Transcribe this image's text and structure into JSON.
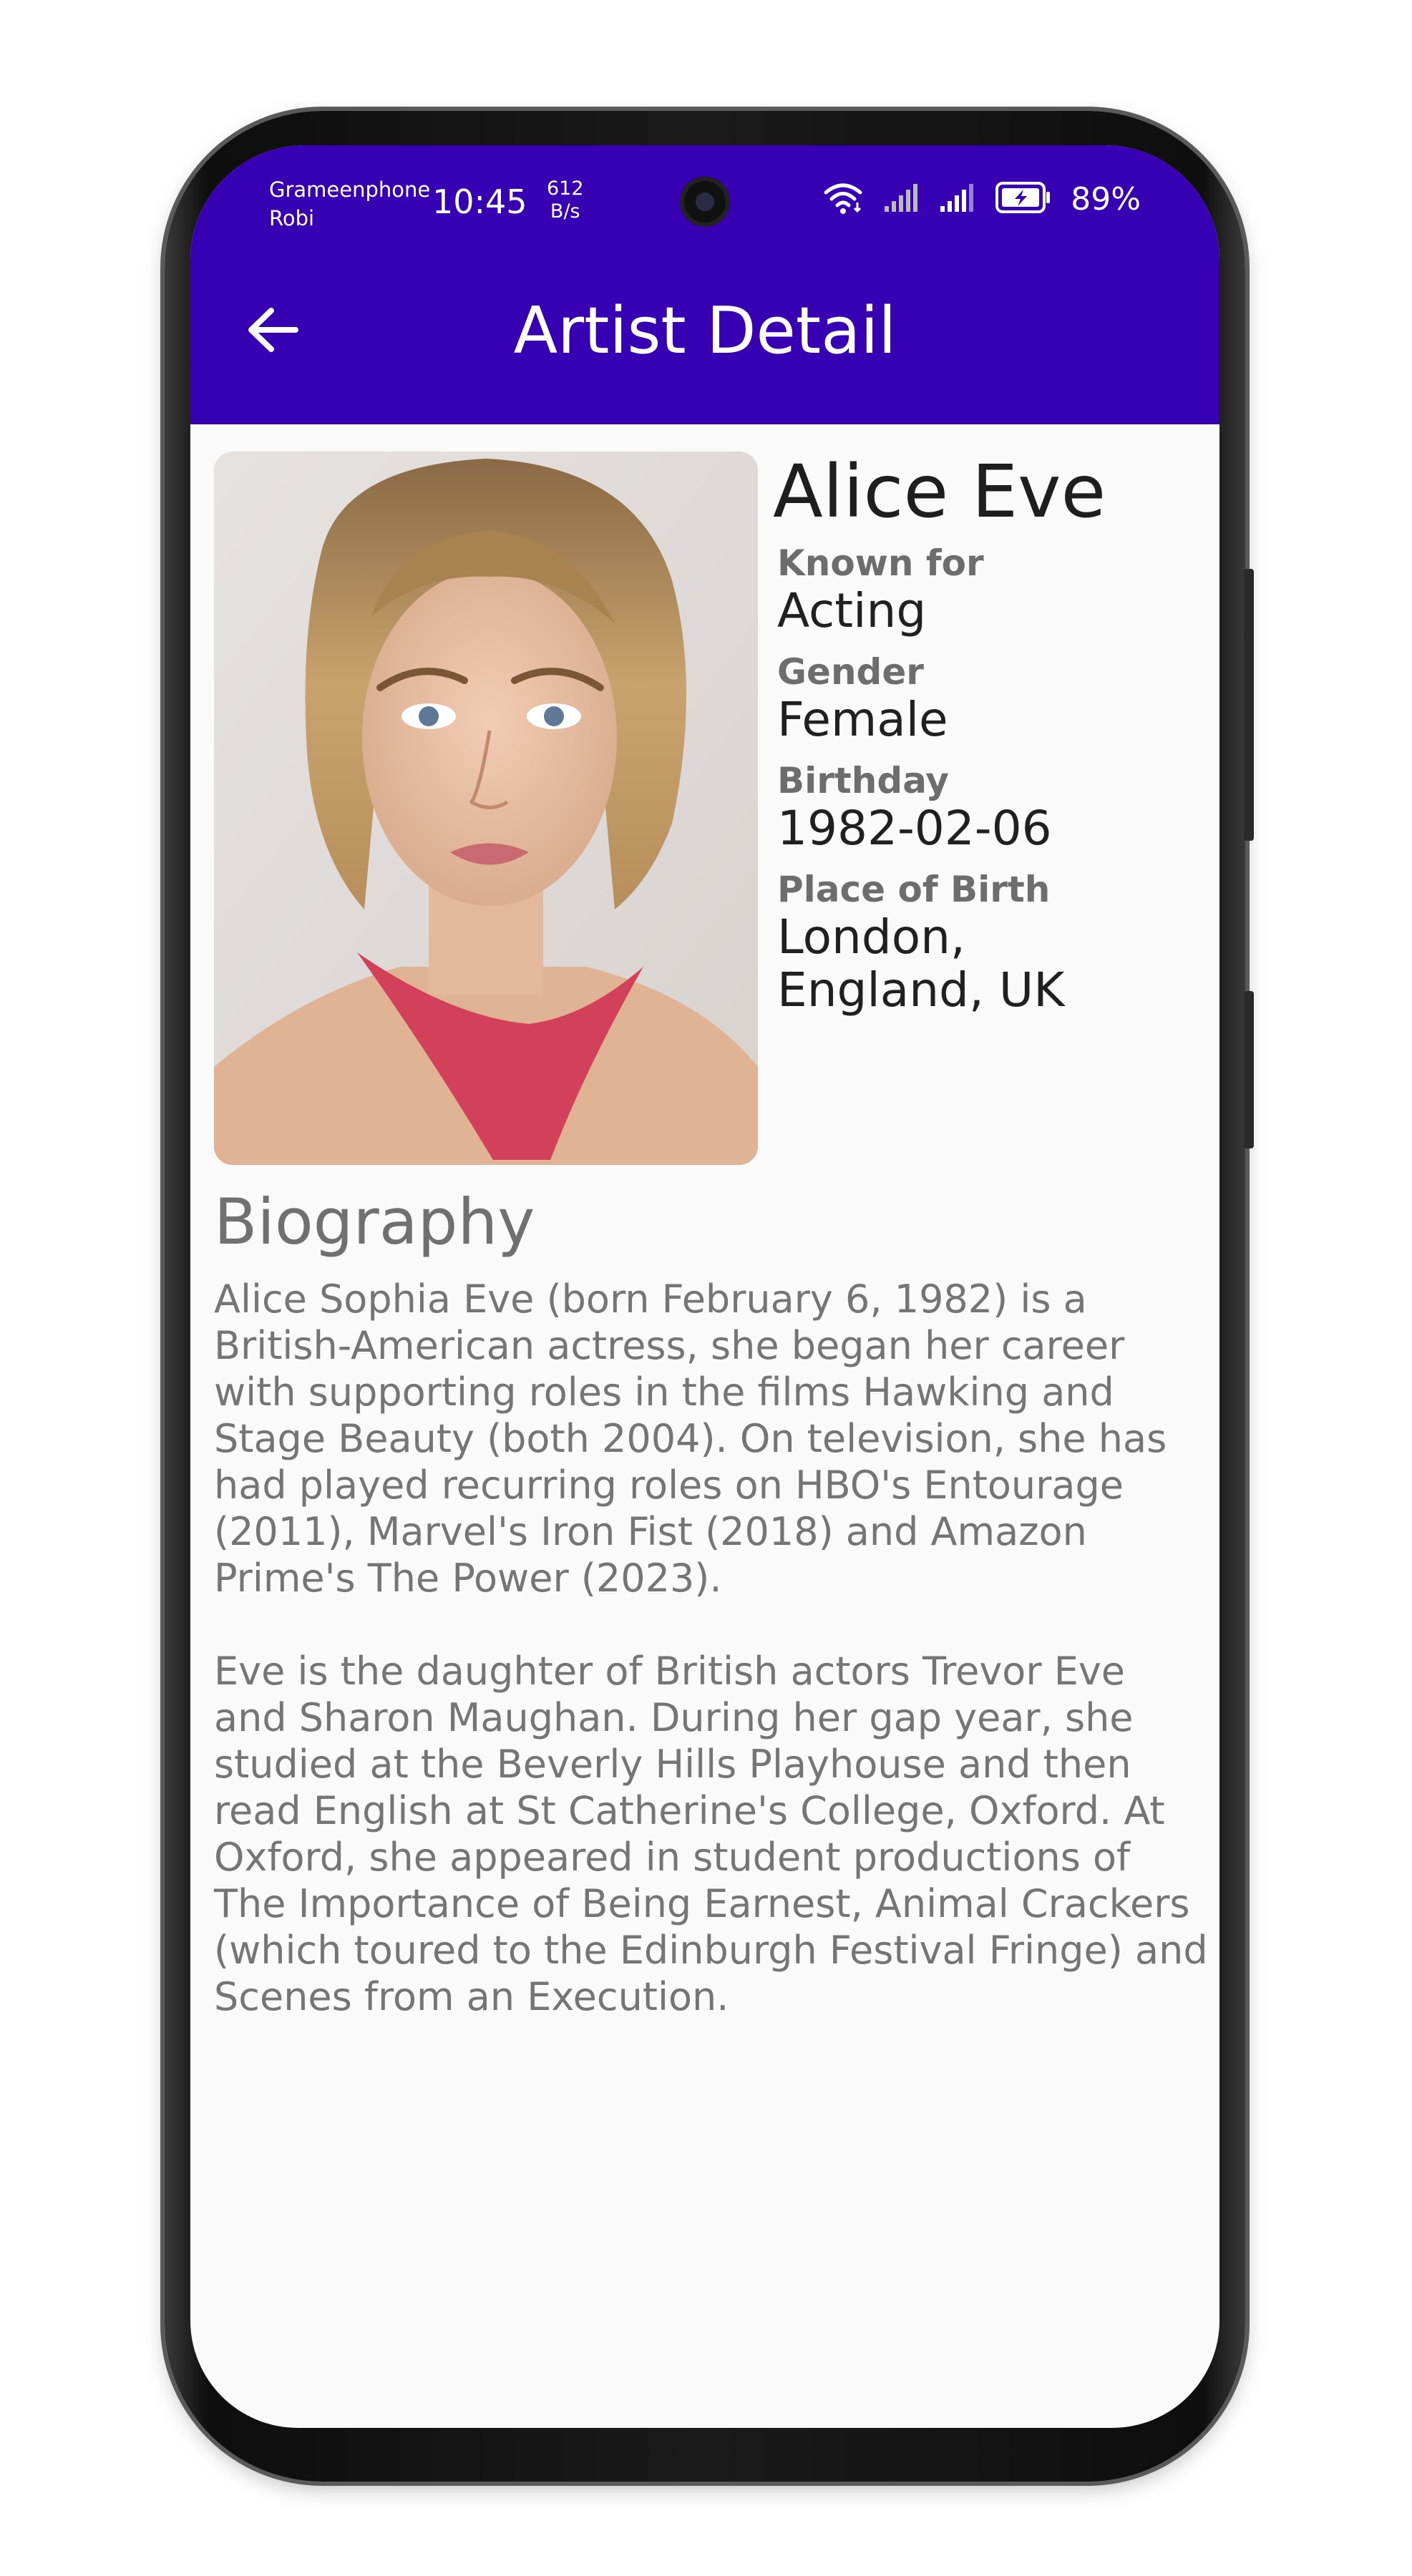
{
  "status_bar": {
    "carrier_1": "Grameenphone",
    "carrier_2": "Robi",
    "time": "10:45",
    "net_speed_value": "612",
    "net_speed_unit": "B/s",
    "battery": "89%"
  },
  "app_bar": {
    "title": "Artist Detail"
  },
  "artist": {
    "name": "Alice Eve",
    "known_for_label": "Known for",
    "known_for": "Acting",
    "gender_label": "Gender",
    "gender": "Female",
    "birthday_label": "Birthday",
    "birthday": "1982-02-06",
    "place_of_birth_label": "Place of Birth",
    "place_of_birth": "London, England, UK"
  },
  "biography": {
    "heading": "Biography",
    "paragraphs": [
      "Alice Sophia Eve (born February 6, 1982) is a British-American actress, she began her career with supporting roles in the films Hawking and Stage Beauty (both 2004). On television, she has had played recurring roles on HBO's Entourage (2011), Marvel's Iron Fist (2018) and Amazon Prime's The Power (2023).",
      "Eve is the daughter of British actors Trevor Eve and Sharon Maughan.  During her gap year, she studied at the Beverly Hills Playhouse and then read English at St Catherine's College, Oxford. At Oxford, she appeared in student productions of The Importance of Being Earnest, Animal Crackers (which toured to the Edinburgh Festival Fringe) and Scenes from an Execution."
    ]
  },
  "colors": {
    "app_bar": "#3700b3",
    "background": "#fafafa",
    "scarf": "#d2405a"
  },
  "icons": {
    "back": "arrow-left-icon",
    "wifi": "wifi-icon",
    "signal": "cell-signal-icon",
    "battery": "battery-charging-icon"
  }
}
